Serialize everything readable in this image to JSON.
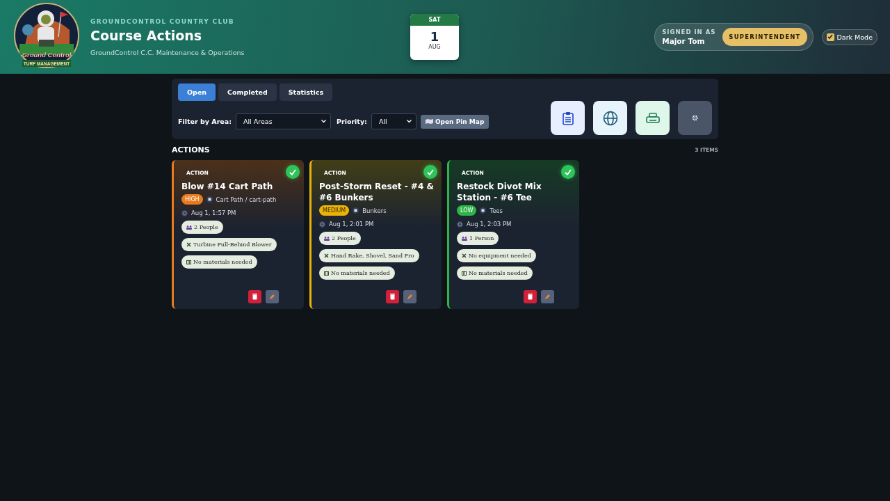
{
  "header": {
    "logo": {
      "title": "Ground Control",
      "subtitle": "TURF MANAGEMENT"
    },
    "club": "GROUNDCONTROL COUNTRY CLUB",
    "title": "Course Actions",
    "subtitle": "GroundControl C.C. Maintenance & Operations",
    "date": {
      "weekday": "SAT",
      "day": "1",
      "month": "AUG"
    },
    "user": {
      "caption": "SIGNED IN AS",
      "name": "Major Tom",
      "role": "SUPERINTENDENT"
    },
    "dark_mode": {
      "label": "Dark Mode",
      "checked": true
    }
  },
  "tabs": [
    {
      "label": "Open",
      "selected": true
    },
    {
      "label": "Completed",
      "selected": false
    },
    {
      "label": "Statistics",
      "selected": false
    }
  ],
  "filters": {
    "area_label": "Filter by Area:",
    "area_value": "All Areas",
    "priority_label": "Priority:",
    "priority_value": "All",
    "map_button": "Open Pin Map"
  },
  "tool_buttons": [
    {
      "kind": "clipboard"
    },
    {
      "kind": "globe"
    },
    {
      "kind": "printer"
    },
    {
      "kind": "gear"
    }
  ],
  "section": {
    "title": "ACTIONS",
    "count": "3 ITEMS"
  },
  "cards": [
    {
      "tag": "ACTION",
      "title": "Blow #14 Cart Path",
      "priority": {
        "label": "HIGH",
        "kind": "high"
      },
      "area": "Cart Path / cart-path",
      "time": "Aug 1, 1:57 PM",
      "people": "2 People",
      "equipment": "Turbine Pull-Behind Blower",
      "materials": "No materials needed"
    },
    {
      "tag": "ACTION",
      "title": "Post-Storm Reset - #4 & #6 Bunkers",
      "priority": {
        "label": "MEDIUM",
        "kind": "medium"
      },
      "area": "Bunkers",
      "time": "Aug 1, 2:01 PM",
      "people": "2 People",
      "equipment": "Hand Rake, Shovel, Sand Pro",
      "materials": "No materials needed"
    },
    {
      "tag": "ACTION",
      "title": "Restock Divot Mix Station - #6 Tee",
      "priority": {
        "label": "LOW",
        "kind": "low"
      },
      "area": "Tees",
      "time": "Aug 1, 2:03 PM",
      "people": "1 Person",
      "equipment": "No equipment needed",
      "materials": "No materials needed"
    }
  ]
}
